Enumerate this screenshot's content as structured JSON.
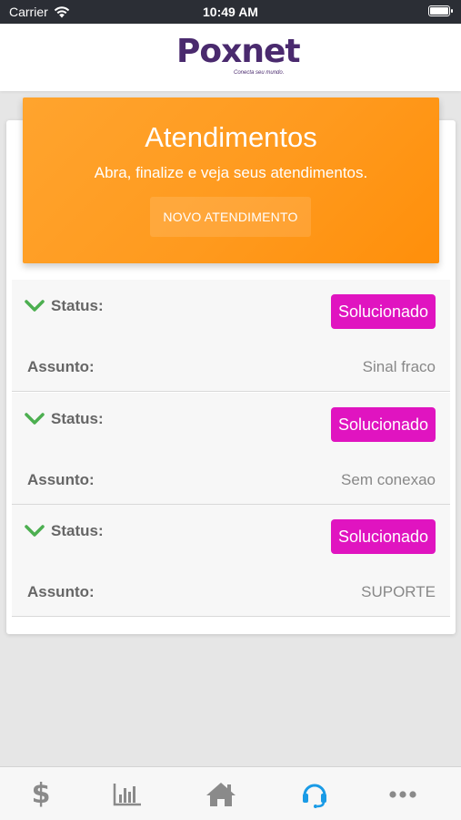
{
  "status_bar": {
    "carrier": "Carrier",
    "time": "10:49 AM"
  },
  "header": {
    "logo_text": "Poxnet",
    "logo_tagline": "Conecta seu mundo."
  },
  "hero": {
    "title": "Atendimentos",
    "subtitle": "Abra, finalize e veja seus atendimentos.",
    "button_label": "NOVO ATENDIMENTO"
  },
  "tickets": [
    {
      "status_label": "Status:",
      "status_value": "Solucionado",
      "subject_label": "Assunto:",
      "subject_value": "Sinal fraco"
    },
    {
      "status_label": "Status:",
      "status_value": "Solucionado",
      "subject_label": "Assunto:",
      "subject_value": "Sem conexao"
    },
    {
      "status_label": "Status:",
      "status_value": "Solucionado",
      "subject_label": "Assunto:",
      "subject_value": "SUPORTE"
    }
  ],
  "tabbar": {
    "items": [
      {
        "icon": "dollar-icon",
        "active": false
      },
      {
        "icon": "bar-chart-icon",
        "active": false
      },
      {
        "icon": "home-icon",
        "active": false
      },
      {
        "icon": "headset-icon",
        "active": true
      },
      {
        "icon": "more-icon",
        "active": false
      }
    ]
  },
  "colors": {
    "hero_orange": "#ff9a1e",
    "badge_magenta": "#e014c0",
    "check_green": "#4caf50",
    "active_tab": "#1a9be6",
    "brand_purple": "#4a2a6e"
  }
}
